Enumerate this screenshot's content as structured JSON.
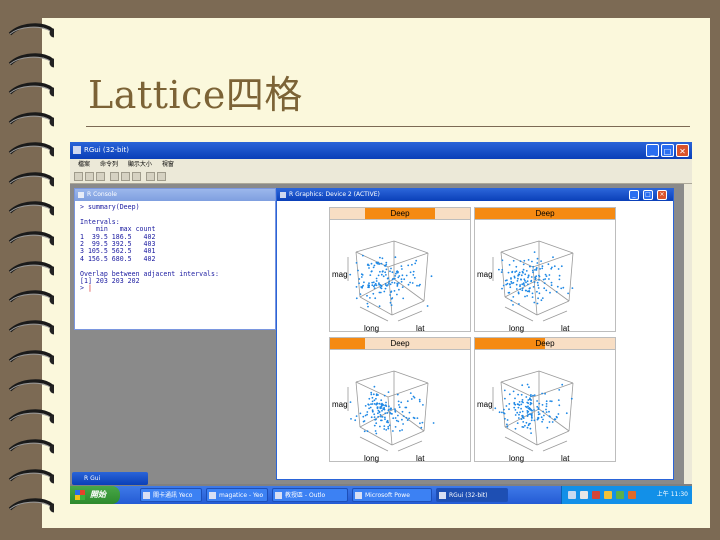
{
  "slide": {
    "title": "Lattice四格",
    "colors": {
      "background": "#7c6a54",
      "slide": "#fbf8dc",
      "title": "#7c6336"
    }
  },
  "rgui": {
    "window_title": "RGui (32-bit)",
    "menu": [
      "檔案",
      "命令列",
      "顯示大小",
      "視窗"
    ],
    "window_buttons": {
      "minimize": "_",
      "restore": "□",
      "close": "✕"
    },
    "console": {
      "title": "R Console",
      "lines": [
        "> summary(Deep)",
        "",
        "Intervals:",
        "    min   max count",
        "1  39.5 186.5   402",
        "2  99.5 392.5   403",
        "3 105.5 562.5   401",
        "4 156.5 680.5   402",
        "",
        "Overlap between adjacent intervals:",
        "[1] 203 203 202",
        "> "
      ]
    },
    "graphics": {
      "title": "R Graphics: Device 2 (ACTIVE)",
      "icons": [
        "minimize-icon",
        "restore-icon",
        "close-icon"
      ]
    },
    "minimized_window": "R Gui"
  },
  "chart_data": [
    {
      "type": "scatter",
      "title": "Deep",
      "strip_fill": 0.25,
      "xlabel": "long",
      "ylabel": "mag",
      "zlabel": "lat",
      "panel": 1
    },
    {
      "type": "scatter",
      "title": "Deep",
      "strip_fill": 0.5,
      "xlabel": "long",
      "ylabel": "mag",
      "zlabel": "lat",
      "panel": 2
    },
    {
      "type": "scatter",
      "title": "Deep",
      "strip_fill": 0.25,
      "xlabel": "long",
      "ylabel": "mag",
      "zlabel": "lat",
      "panel": 3
    },
    {
      "type": "scatter",
      "title": "Deep",
      "strip_fill": 0.75,
      "xlabel": "long",
      "ylabel": "mag",
      "zlabel": "lat",
      "panel": 4
    }
  ],
  "taskbar": {
    "start": "開始",
    "tasks": [
      "關卡通訊 Yeco",
      "magatice - Yeo",
      "教授區 - Outlo",
      "Microsoft Powe",
      "RGui (32-bit)"
    ],
    "clock": "上午 11:30"
  }
}
